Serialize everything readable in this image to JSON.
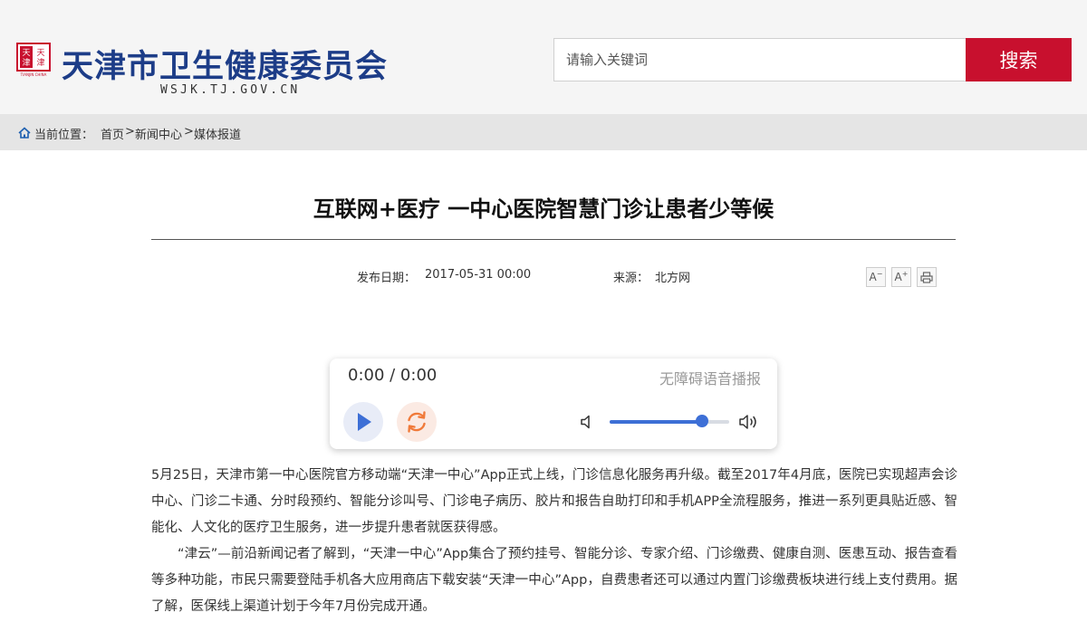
{
  "header": {
    "site_title": "天津市卫生健康委员会",
    "site_url": "WSJK.TJ.GOV.CN",
    "logo_text": "天津 TIANJIN CHINA",
    "search": {
      "placeholder": "请输入关键词",
      "button_label": "搜索"
    }
  },
  "breadcrumb": {
    "prefix": "当前位置：",
    "items": [
      "首页",
      "新闻中心",
      "媒体报道"
    ],
    "separator": ">"
  },
  "article": {
    "title": "互联网+医疗 一中心医院智慧门诊让患者少等候",
    "publish_label": "发布日期：",
    "publish_date": "2017-05-31 00:00",
    "source_label": "来源：",
    "source": "北方网",
    "tools": {
      "font_decrease": "A",
      "font_increase": "A",
      "print_icon": "printer-icon"
    },
    "paragraphs": [
      "5月25日，天津市第一中心医院官方移动端“天津一中心”App正式上线，门诊信息化服务再升级。截至2017年4月底，医院已实现超声会诊中心、门诊二卡通、分时段预约、智能分诊叫号、门诊电子病历、胶片和报告自助打印和手机APP全流程服务，推进一系列更具贴近感、智能化、人文化的医疗卫生服务，进一步提升患者就医获得感。",
      "“津云”—前沿新闻记者了解到，“天津一中心”App集合了预约挂号、智能分诊、专家介绍、门诊缴费、健康自测、医患互动、报告查看等多种功能，市民只需要登陆手机各大应用商店下载安装“天津一中心”App，自费患者还可以通过内置门诊缴费板块进行线上支付费用。据了解，医保线上渠道计划于今年7月份完成开通。"
    ]
  },
  "player": {
    "time": "0:00 / 0:00",
    "tag": "无障碍语音播报",
    "volume_fraction": 0.77,
    "icons": [
      "play-icon",
      "refresh-icon",
      "volume-low-icon",
      "volume-high-icon"
    ]
  },
  "colors": {
    "brand_blue": "#1d3d88",
    "search_red": "#c8102e",
    "player_accent": "#3d6fd6",
    "refresh_accent": "#f07a3a"
  }
}
